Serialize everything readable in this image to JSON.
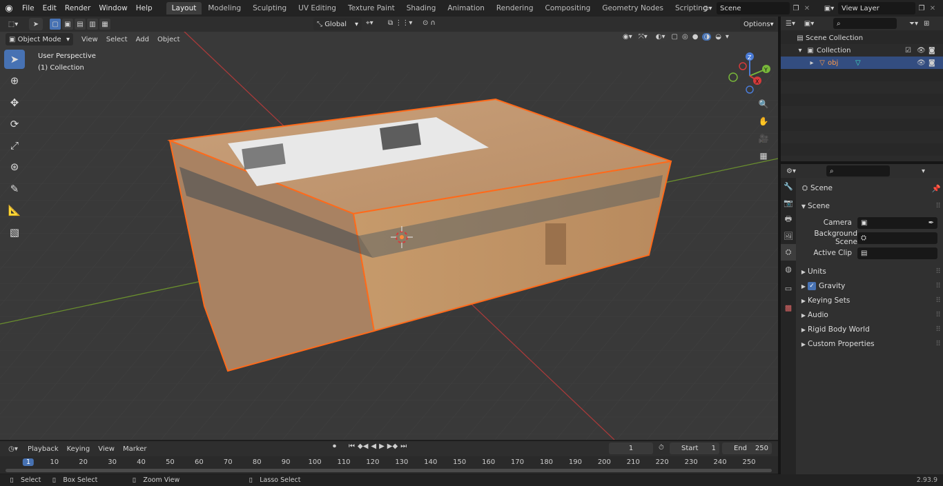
{
  "menu": [
    "File",
    "Edit",
    "Render",
    "Window",
    "Help"
  ],
  "workspaces": [
    {
      "label": "Layout",
      "active": true
    },
    {
      "label": "Modeling"
    },
    {
      "label": "Sculpting"
    },
    {
      "label": "UV Editing"
    },
    {
      "label": "Texture Paint"
    },
    {
      "label": "Shading"
    },
    {
      "label": "Animation"
    },
    {
      "label": "Rendering"
    },
    {
      "label": "Compositing"
    },
    {
      "label": "Geometry Nodes"
    },
    {
      "label": "Scripting"
    }
  ],
  "scene": {
    "name": "Scene"
  },
  "view_layer": {
    "name": "View Layer"
  },
  "viewport": {
    "mode": "Object Mode",
    "menus": [
      "View",
      "Select",
      "Add",
      "Object"
    ],
    "transform": "Global",
    "options": "Options",
    "perspective": "User Perspective",
    "collection": "(1) Collection",
    "axes": {
      "z": "Z",
      "y": "Y",
      "x": "X"
    }
  },
  "outliner": {
    "root": "Scene Collection",
    "collection": "Collection",
    "object": "obj"
  },
  "properties": {
    "title": "Scene",
    "section": "Scene",
    "camera_label": "Camera",
    "bg_scene_label": "Background Scene",
    "active_clip_label": "Active Clip",
    "panels": [
      "Units",
      "Gravity",
      "Keying Sets",
      "Audio",
      "Rigid Body World",
      "Custom Properties"
    ]
  },
  "timeline": {
    "menus": [
      "Playback",
      "Keying",
      "View",
      "Marker"
    ],
    "current_frame": "1",
    "start_label": "Start",
    "start": "1",
    "end_label": "End",
    "end": "250",
    "ruler": [
      "1",
      "10",
      "20",
      "30",
      "40",
      "50",
      "60",
      "70",
      "80",
      "90",
      "100",
      "110",
      "120",
      "130",
      "140",
      "150",
      "160",
      "170",
      "180",
      "190",
      "200",
      "210",
      "220",
      "230",
      "240",
      "250"
    ]
  },
  "status": {
    "select": "Select",
    "box_select": "Box Select",
    "zoom": "Zoom View",
    "lasso": "Lasso Select",
    "version": "2.93.9"
  },
  "colors": {
    "accent": "#4772b3",
    "selection": "#ff6a1a",
    "viewport_bg": "#393939"
  }
}
